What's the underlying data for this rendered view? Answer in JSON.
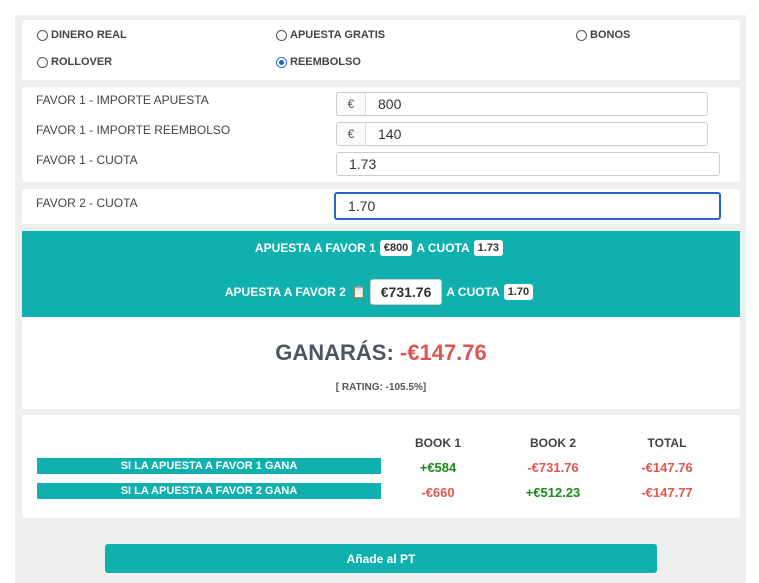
{
  "mode_options": {
    "real_money": "DINERO REAL",
    "free_bet": "APUESTA GRATIS",
    "bonuses": "BONOS",
    "rollover": "ROLLOVER",
    "refund": "REEMBOLSO",
    "selected": "REEMBOLSO"
  },
  "favor1": {
    "stake_label": "FAVOR 1 - IMPORTE APUESTA",
    "stake_currency": "€",
    "stake_value": "800",
    "refund_label": "FAVOR 1 - IMPORTE REEMBOLSO",
    "refund_currency": "€",
    "refund_value": "140",
    "odds_label": "FAVOR 1 - CUOTA",
    "odds_value": "1.73"
  },
  "favor2": {
    "odds_label": "FAVOR 2 - CUOTA",
    "odds_value": "1.70"
  },
  "summary": {
    "bet1_prefix": "APUESTA A FAVOR 1",
    "bet1_amount": "€800",
    "bet1_odds_prefix": "A CUOTA",
    "bet1_odds": "1.73",
    "bet2_prefix": "APUESTA A FAVOR 2",
    "bet2_amount": "€731.76",
    "bet2_odds_prefix": "A CUOTA",
    "bet2_odds": "1.70",
    "copy_icon": "clipboard-icon"
  },
  "result": {
    "label": "GANARÁS:",
    "value": "-€147.76",
    "rating": "[ RATING: -105.5%]"
  },
  "table": {
    "headers": [
      "BOOK 1",
      "BOOK 2",
      "TOTAL"
    ],
    "rows": [
      {
        "label": "SI LA APUESTA A FAVOR 1 GANA",
        "book1": "+€584",
        "book2": "-€731.76",
        "total": "-€147.76"
      },
      {
        "label": "SI LA APUESTA A FAVOR 2 GANA",
        "book1": "-€660",
        "book2": "+€512.23",
        "total": "-€147.77"
      }
    ]
  },
  "actions": {
    "add_label": "Añade al PT"
  },
  "colors": {
    "accent": "#10b0ae",
    "positive": "#1a8a1a",
    "negative": "#e0554f"
  }
}
